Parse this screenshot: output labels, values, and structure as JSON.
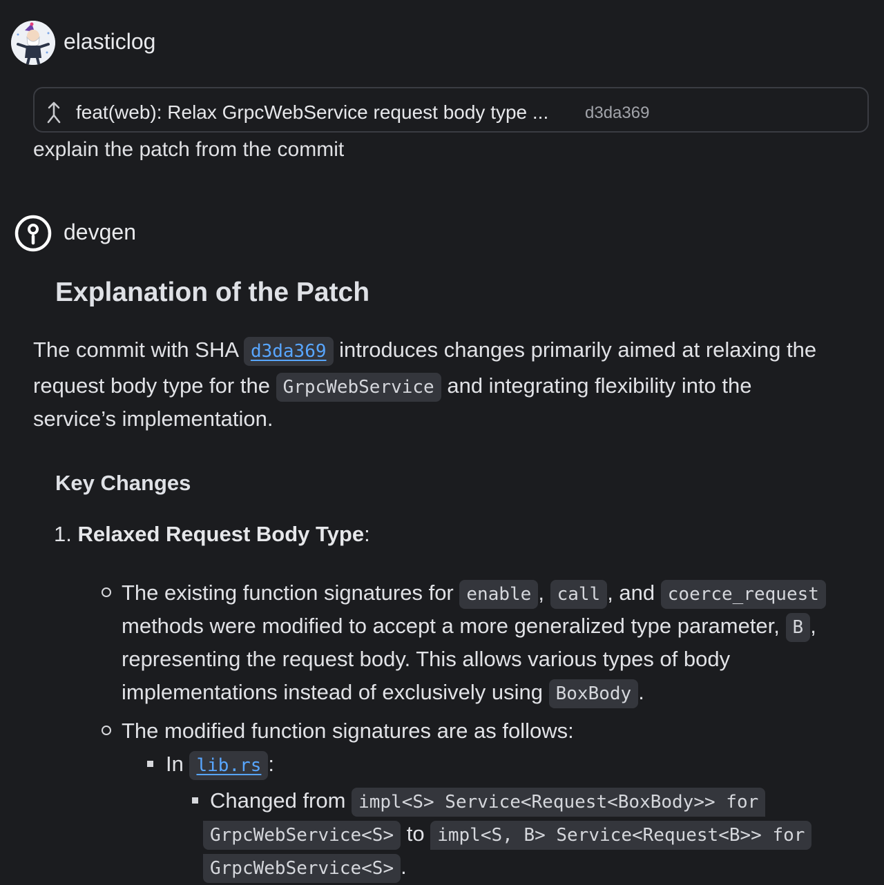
{
  "user": {
    "name": "elasticlog"
  },
  "commit": {
    "title": "feat(web): Relax GrpcWebService request body type ...",
    "sha": "d3da369"
  },
  "prompt": "explain the patch from the commit",
  "bot": {
    "name": "devgen"
  },
  "response": {
    "heading": "Explanation of the Patch",
    "intro": {
      "t1": "The commit with SHA",
      "sha_code": "d3da369",
      "t2": "introduces changes primarily aimed at relaxing the",
      "t3": "request body type for the",
      "service_code": "GrpcWebService",
      "t4": "and integrating flexibility into the",
      "t5": "service’s implementation."
    },
    "key_changes_heading": "Key Changes",
    "item1": {
      "number": "1.",
      "title": "Relaxed Request Body Type",
      "colon": ":"
    },
    "bullet1": {
      "t1": "The existing function signatures for",
      "code1": "enable",
      "sep1": ",",
      "code2": "call",
      "sep2": ", and",
      "code3": "coerce_request",
      "t2": "methods were modified to accept a more generalized type parameter,",
      "code4": "B",
      "sep3": ",",
      "t3": "representing the request body. This allows various types of body",
      "t4": "implementations instead of exclusively using",
      "code5": "BoxBody",
      "end": "."
    },
    "bullet2": {
      "text": "The modified function signatures are as follows:"
    },
    "sub_bullet": {
      "prefix": "In",
      "file": "lib.rs",
      "suffix": ":"
    },
    "change": {
      "t1": "Changed from",
      "from_a": "impl<S> Service<Request<BoxBody>> for",
      "from_b": "GrpcWebService<S>",
      "t2": "to",
      "to_a": "impl<S, B> Service<Request<B>> for",
      "to_b": "GrpcWebService<S>",
      "end": "."
    }
  }
}
